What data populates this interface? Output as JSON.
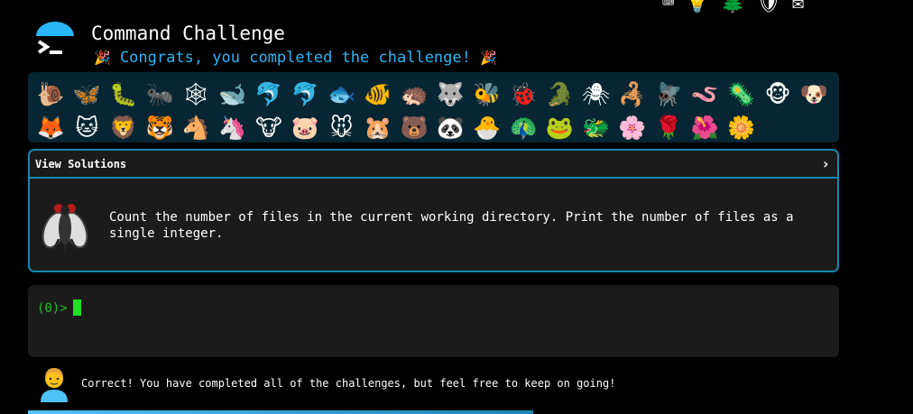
{
  "header": {
    "title": "Command Challenge",
    "subtitle": "Congrats, you completed the challenge!",
    "party_icon": "🎉"
  },
  "top_icons": [
    {
      "name": "terminal-icon",
      "glyph": "⌨"
    },
    {
      "name": "lightbulb-icon",
      "glyph": "💡"
    },
    {
      "name": "tree-icon",
      "glyph": "🌲"
    },
    {
      "name": "badge-icon",
      "glyph": "🛡"
    },
    {
      "name": "mail-icon",
      "glyph": "✉"
    }
  ],
  "emojis": [
    [
      "🐌",
      "🦋",
      "🐛",
      "🐜",
      "🕸",
      "🐋",
      "🐬",
      "🐬",
      "🐟",
      "🐠",
      "🦔",
      "🐺",
      "🐝",
      "🐞",
      "🐊",
      "🕷",
      "🦂",
      "🪰",
      "🪱",
      "🦠",
      "🐵",
      "🐶"
    ],
    [
      "🦊",
      "🐱",
      "🦁",
      "🐯",
      "🐴",
      "🦄",
      "🐮",
      "🐷",
      "🐭",
      "🐹",
      "🐻",
      "🐼",
      "🐣",
      "🦚",
      "🐸",
      "🐲",
      "🌸",
      "🌹",
      "🌺",
      "🌼"
    ]
  ],
  "challenge": {
    "header": "View Solutions",
    "text": "Count the number of files in the current working directory. Print the number of files as a single integer."
  },
  "terminal": {
    "prompt": "(0)>"
  },
  "footer": {
    "message": "Correct! You have completed all of the challenges, but feel free to keep on going!"
  },
  "colors": {
    "accent": "#29b6f6",
    "border": "#1587b0",
    "prompt": "#21c021"
  }
}
